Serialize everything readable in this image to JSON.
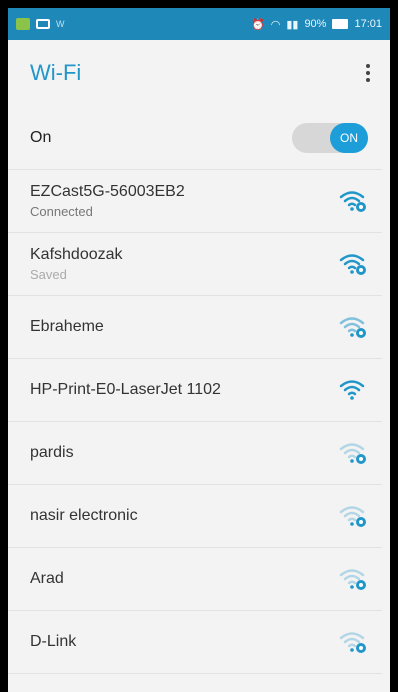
{
  "status_bar": {
    "small_text": "W",
    "battery": "90%",
    "time": "17:01"
  },
  "header": {
    "title": "Wi-Fi"
  },
  "master_switch": {
    "label": "On",
    "toggle_text": "ON"
  },
  "networks": [
    {
      "ssid": "EZCast5G-56003EB2",
      "status": "Connected",
      "signal": "strong",
      "secured": true
    },
    {
      "ssid": "Kafshdoozak",
      "status": "Saved",
      "signal": "strong",
      "secured": true
    },
    {
      "ssid": "Ebraheme",
      "status": "",
      "signal": "medium",
      "secured": true
    },
    {
      "ssid": "HP-Print-E0-LaserJet 1102",
      "status": "",
      "signal": "strong",
      "secured": false
    },
    {
      "ssid": "pardis",
      "status": "",
      "signal": "weak",
      "secured": true
    },
    {
      "ssid": "nasir electronic",
      "status": "",
      "signal": "weak",
      "secured": true
    },
    {
      "ssid": "Arad",
      "status": "",
      "signal": "weak",
      "secured": true
    },
    {
      "ssid": "D-Link",
      "status": "",
      "signal": "weak",
      "secured": true
    }
  ],
  "colors": {
    "accent": "#2196c9",
    "status_bar": "#1e88b9",
    "toggle_on": "#1e9ed8"
  }
}
